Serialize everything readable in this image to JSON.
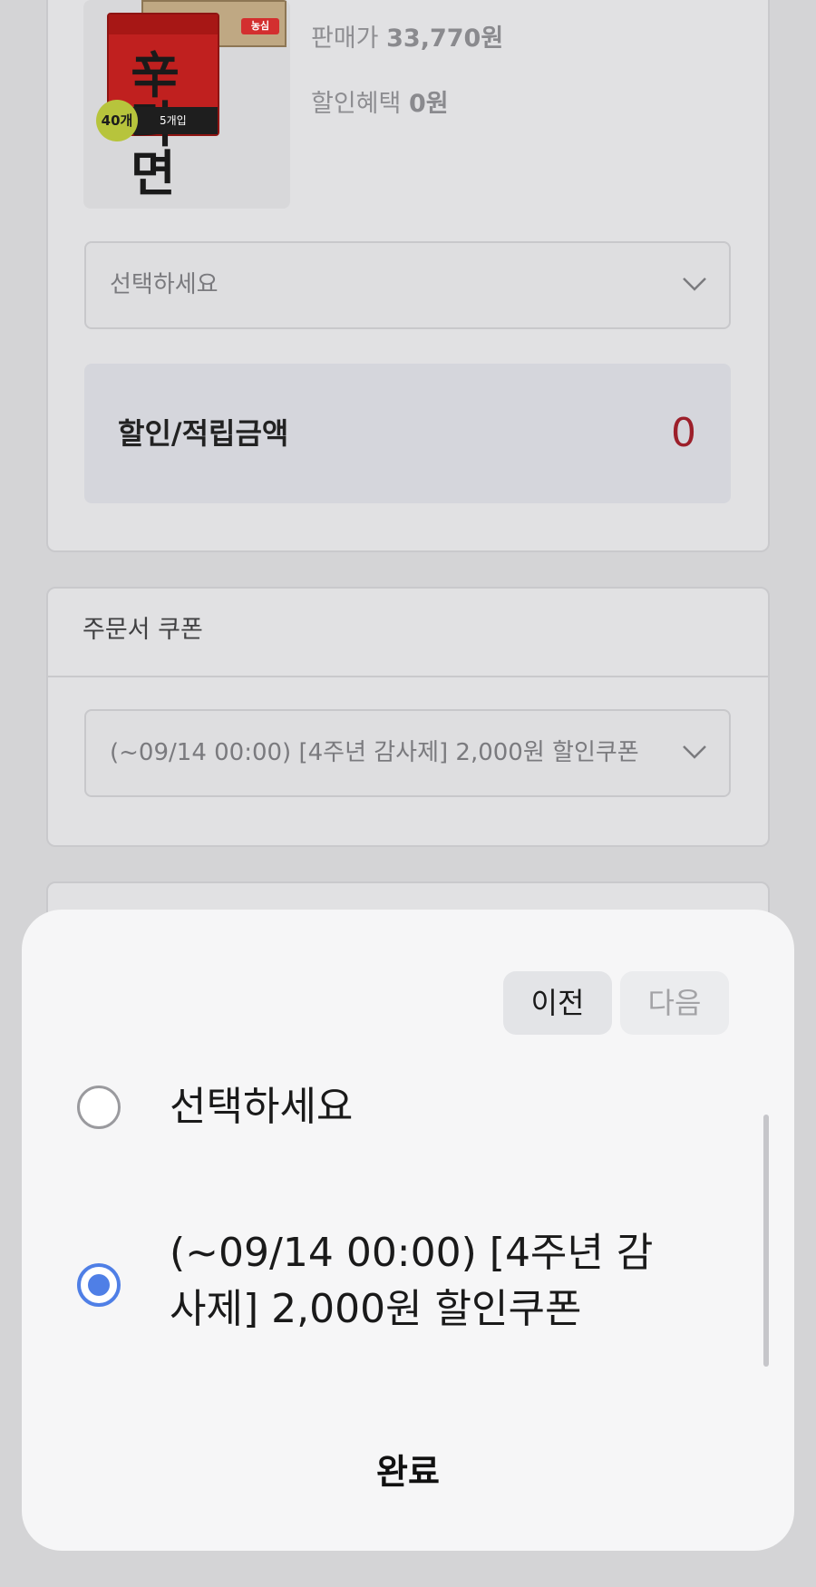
{
  "product": {
    "box_brand": "농심",
    "pack_name": "辛라면",
    "pack_count_label": "5개입",
    "quantity_badge": "40개",
    "price_label": "판매가",
    "price_value": "33,770원",
    "benefit_label": "할인혜택",
    "benefit_value": "0원"
  },
  "option_select": {
    "value": "선택하세요"
  },
  "discount_summary": {
    "label": "할인/적립금액",
    "value": "0"
  },
  "order_coupon": {
    "title": "주문서 쿠폰",
    "selected_value": "(~09/14 00:00) [4주년 감사제] 2,000원 할인쿠폰"
  },
  "picker_sheet": {
    "prev_label": "이전",
    "next_label": "다음",
    "options": [
      {
        "label": "선택하세요",
        "selected": false
      },
      {
        "label": "(~09/14 00:00) [4주년 감사제] 2,000원 할인쿠폰",
        "selected": true
      }
    ],
    "done_label": "완료"
  },
  "colors": {
    "accent_radio": "#4f7fe6",
    "amount_value": "#9c1f2a",
    "overlay_background": "#d4d4d6",
    "sheet_background": "#f6f6f7"
  }
}
